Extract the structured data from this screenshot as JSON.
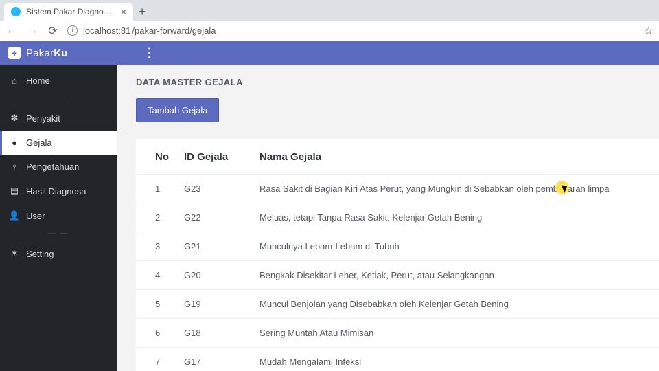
{
  "browser": {
    "tab_title": "Sistem Pakar Diagnosa Penyakit L",
    "url_host": "localhost:81",
    "url_path": "/pakar-forward/gejala"
  },
  "header": {
    "brand_left": "Pakar",
    "brand_right": "Ku"
  },
  "sidebar": {
    "items": [
      {
        "icon": "home",
        "label": "Home",
        "active": false
      },
      {
        "icon": "disease",
        "label": "Penyakit",
        "active": false
      },
      {
        "icon": "alert",
        "label": "Gejala",
        "active": true
      },
      {
        "icon": "bulb",
        "label": "Pengetahuan",
        "active": false
      },
      {
        "icon": "doc",
        "label": "Hasil Diagnosa",
        "active": false
      },
      {
        "icon": "user",
        "label": "User",
        "active": false
      },
      {
        "icon": "gear",
        "label": "Setting",
        "active": false
      }
    ]
  },
  "page": {
    "title": "DATA MASTER GEJALA",
    "add_button": "Tambah Gejala",
    "columns": {
      "no": "No",
      "id": "ID Gejala",
      "nama": "Nama Gejala"
    },
    "rows": [
      {
        "no": "1",
        "id": "G23",
        "nama": "Rasa Sakit di Bagian Kiri Atas Perut, yang Mungkin di Sebabkan oleh pembesaran limpa"
      },
      {
        "no": "2",
        "id": "G22",
        "nama": "Meluas, tetapi Tanpa Rasa Sakit, Kelenjar Getah Bening"
      },
      {
        "no": "3",
        "id": "G21",
        "nama": "Munculnya Lebam-Lebam di Tubuh"
      },
      {
        "no": "4",
        "id": "G20",
        "nama": "Bengkak Disekitar Leher, Ketiak, Perut, atau Selangkangan"
      },
      {
        "no": "5",
        "id": "G19",
        "nama": "Muncul Benjolan yang Disebabkan oleh Kelenjar Getah Bening"
      },
      {
        "no": "6",
        "id": "G18",
        "nama": "Sering Muntah Atau Mimisan"
      },
      {
        "no": "7",
        "id": "G17",
        "nama": "Mudah Mengalami Infeksi"
      }
    ]
  }
}
